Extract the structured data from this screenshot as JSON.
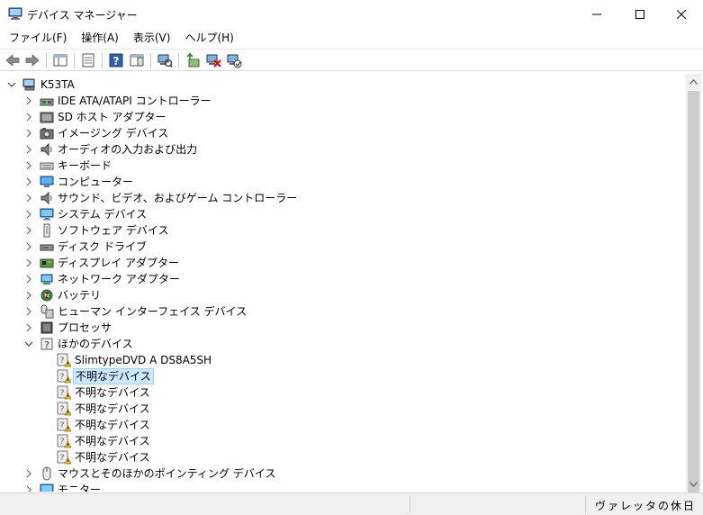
{
  "window": {
    "title": "デバイス マネージャー"
  },
  "menu": [
    {
      "label": "ファイル(F)"
    },
    {
      "label": "操作(A)"
    },
    {
      "label": "表示(V)"
    },
    {
      "label": "ヘルプ(H)"
    }
  ],
  "tree": {
    "root": "K53TA",
    "items": [
      {
        "label": "IDE ATA/ATAPI コントローラー",
        "icon": "ide-controller-icon"
      },
      {
        "label": "SD ホスト アダプター",
        "icon": "sd-host-icon"
      },
      {
        "label": "イメージング デバイス",
        "icon": "camera-icon"
      },
      {
        "label": "オーディオの入力および出力",
        "icon": "speaker-icon"
      },
      {
        "label": "キーボード",
        "icon": "keyboard-icon"
      },
      {
        "label": "コンピューター",
        "icon": "computer-icon"
      },
      {
        "label": "サウンド、ビデオ、およびゲーム コントローラー",
        "icon": "speaker-icon"
      },
      {
        "label": "システム デバイス",
        "icon": "monitor-icon"
      },
      {
        "label": "ソフトウェア デバイス",
        "icon": "software-device-icon"
      },
      {
        "label": "ディスク ドライブ",
        "icon": "disk-drive-icon"
      },
      {
        "label": "ディスプレイ アダプター",
        "icon": "display-adapter-icon"
      },
      {
        "label": "ネットワーク アダプター",
        "icon": "network-icon"
      },
      {
        "label": "バッテリ",
        "icon": "battery-icon"
      },
      {
        "label": "ヒューマン インターフェイス デバイス",
        "icon": "hid-icon"
      },
      {
        "label": "プロセッサ",
        "icon": "processor-icon"
      },
      {
        "label": "ほかのデバイス",
        "icon": "other-devices-icon",
        "expanded": true
      }
    ],
    "other_devices": [
      {
        "label": "SlimtypeDVD A  DS8A5SH"
      },
      {
        "label": "不明なデバイス",
        "selected": true
      },
      {
        "label": "不明なデバイス"
      },
      {
        "label": "不明なデバイス"
      },
      {
        "label": "不明なデバイス"
      },
      {
        "label": "不明なデバイス"
      },
      {
        "label": "不明なデバイス"
      }
    ],
    "after": [
      {
        "label": "マウスとそのほかのポインティング デバイス",
        "icon": "mouse-icon"
      },
      {
        "label": "モニター",
        "icon": "monitor-icon"
      }
    ]
  },
  "status": {
    "text": "ヴァレッタの休日"
  },
  "colors": {
    "selection_bg": "#cce8ff",
    "selection_border": "#99d1ff",
    "warning": "#f2c300"
  }
}
